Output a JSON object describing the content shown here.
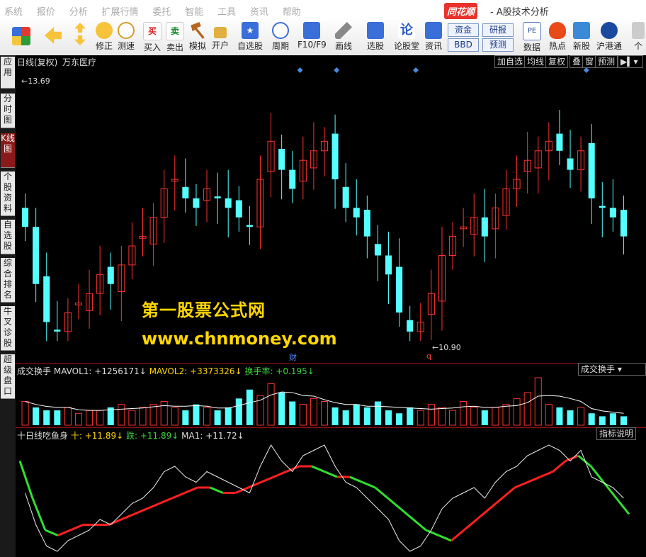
{
  "menu": {
    "items": [
      "系统",
      "报价",
      "分析",
      "扩展行情",
      "委托",
      "智能",
      "工具",
      "资讯",
      "帮助"
    ],
    "brand": "同花顺",
    "brand_sub": "- A股技术分析"
  },
  "toolbar": {
    "buttons": [
      {
        "label": "修正"
      },
      {
        "label": "测速"
      },
      {
        "label": "买入"
      },
      {
        "label": "卖出"
      },
      {
        "label": "模拟"
      },
      {
        "label": "开户"
      },
      {
        "label": "自选股"
      },
      {
        "label": "周期"
      },
      {
        "label": "F10/F9"
      },
      {
        "label": "画线"
      },
      {
        "label": "选股"
      },
      {
        "label": "论股堂"
      },
      {
        "label": "资讯"
      },
      {
        "label": "数据"
      },
      {
        "label": "热点"
      },
      {
        "label": "新股"
      },
      {
        "label": "沪港通"
      },
      {
        "label": "个"
      }
    ],
    "box_buttons": [
      "资金",
      "研报",
      "BBD",
      "预测"
    ]
  },
  "sidebar": {
    "tabs": [
      "应用",
      "分时图",
      "K线图",
      "个股资料",
      "自选股",
      "综合排名",
      "牛叉诊股",
      "超级盘口"
    ],
    "active": "K线图"
  },
  "chart_header": {
    "period": "日线(复权)",
    "stock": "万东医疗",
    "buttons": [
      "加自选",
      "均线",
      "复权",
      "叠",
      "窗",
      "预测"
    ]
  },
  "price_labels": {
    "high": "13.69",
    "low": "10.90"
  },
  "markers": {
    "cai": "财",
    "q": "q"
  },
  "volume_panel": {
    "title": "成交换手",
    "mavol1": "MAVOL1: +1256171↓",
    "mavol2": "MAVOL2: +3373326↓",
    "turnover": "换手率: +0.195↓",
    "button": "成交换手"
  },
  "indicator_panel": {
    "title": "十日线吃鱼身",
    "shi": "十: +11.89↓",
    "die": "跌: +11.89↓",
    "ma1": "MA1: +11.72↓",
    "button": "指标说明"
  },
  "watermark": {
    "line1": "第一股票公式网",
    "line2": "www.chnmoney.com"
  },
  "colors": {
    "up": "#ff3232",
    "down": "#54ffff",
    "panel_border": "#a01010",
    "watermark": "#ffd700"
  },
  "chart_data": {
    "type": "candlestick",
    "title": "",
    "price_high": 13.69,
    "price_low": 10.9,
    "close_series": [
      12.1,
      11.5,
      11.1,
      11.0,
      11.2,
      11.3,
      11.4,
      11.6,
      11.5,
      11.7,
      11.9,
      12.0,
      12.2,
      12.5,
      12.6,
      12.4,
      12.3,
      12.5,
      12.4,
      12.3,
      12.2,
      12.1,
      12.6,
      13.0,
      12.7,
      12.5,
      12.8,
      12.9,
      13.0,
      12.6,
      12.3,
      12.2,
      12.0,
      11.8,
      11.6,
      11.2,
      11.0,
      11.1,
      11.4,
      11.8,
      12.0,
      12.1,
      12.2,
      12.0,
      12.3,
      12.5,
      12.6,
      12.8,
      12.9,
      13.0,
      12.9,
      12.7,
      12.9,
      12.4,
      12.3,
      12.2,
      12.0
    ],
    "volume_series": [
      0.8,
      0.6,
      0.5,
      0.5,
      0.6,
      0.4,
      0.5,
      0.5,
      0.6,
      0.7,
      0.5,
      0.6,
      0.7,
      0.8,
      0.6,
      0.5,
      0.7,
      0.6,
      0.5,
      0.6,
      0.9,
      1.2,
      1.0,
      1.4,
      1.1,
      0.8,
      0.7,
      0.9,
      0.8,
      0.6,
      0.5,
      0.7,
      0.6,
      0.8,
      0.5,
      0.4,
      0.6,
      0.5,
      0.7,
      0.6,
      0.5,
      0.8,
      0.6,
      0.5,
      0.6,
      0.7,
      0.9,
      1.1,
      1.6,
      0.7,
      0.6,
      0.5,
      0.6,
      0.4,
      0.3,
      0.4,
      0.3
    ],
    "indicator_fish": [
      12.9,
      12.2,
      11.6,
      11.5,
      11.6,
      11.7,
      11.7,
      11.7,
      11.8,
      11.9,
      12.0,
      12.1,
      12.2,
      12.3,
      12.4,
      12.4,
      12.3,
      12.3,
      12.4,
      12.5,
      12.6,
      12.7,
      12.8,
      12.8,
      12.7,
      12.6,
      12.6,
      12.5,
      12.4,
      12.2,
      12.0,
      11.8,
      11.6,
      11.5,
      11.4,
      11.6,
      11.8,
      12.0,
      12.2,
      12.4,
      12.5,
      12.6,
      12.7,
      12.9,
      13.0,
      12.8,
      12.5,
      12.2,
      11.9
    ]
  }
}
